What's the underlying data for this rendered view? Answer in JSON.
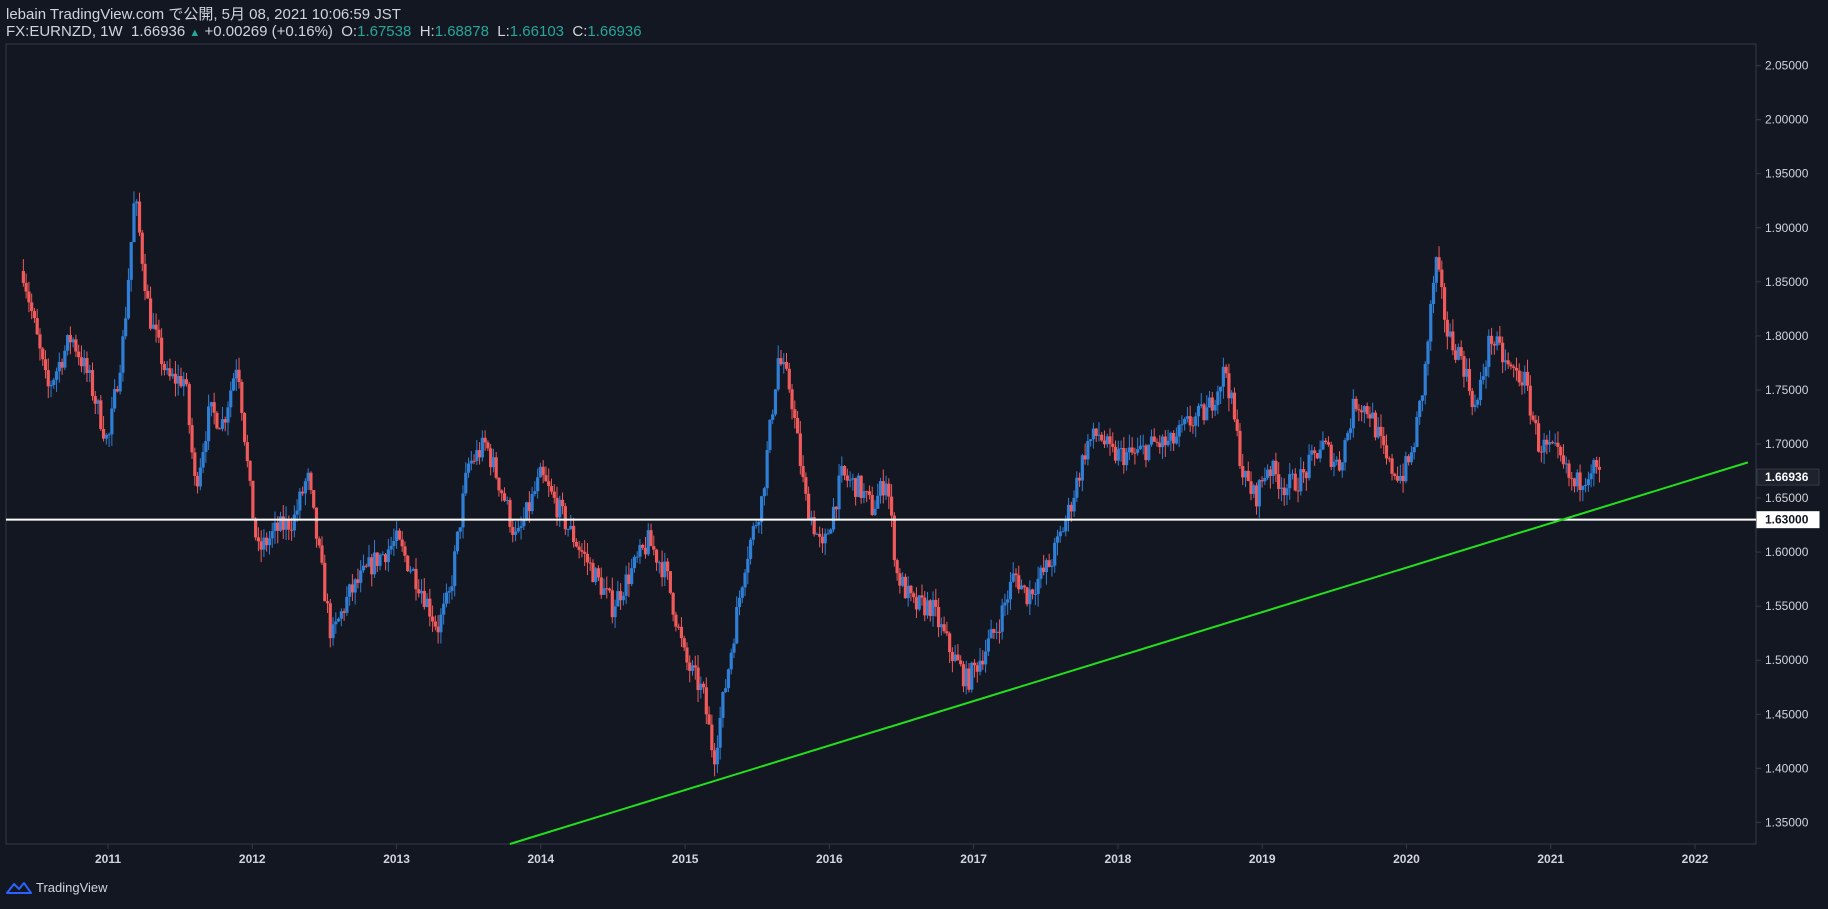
{
  "header": {
    "line1": "lebain TradingView.com で公開, 5月 08, 2021 10:06:59 JST",
    "symbol": "FX:EURNZD, 1W",
    "last": "1.66936",
    "change": "+0.00269 (+0.16%)",
    "o_label": "O:",
    "o": "1.67538",
    "h_label": "H:",
    "h": "1.68878",
    "l_label": "L:",
    "l": "1.66103",
    "c_label": "C:",
    "c": "1.66936"
  },
  "footer": {
    "brand": "TradingView",
    "icon": "tradingview-logo-icon"
  },
  "colors": {
    "background": "#131722",
    "up": "#2f7fd6",
    "down": "#f05a5a",
    "trendline": "#22e01d",
    "hline": "#ffffff",
    "axis_text": "#d1d4dc"
  },
  "chart_data": {
    "type": "candlestick",
    "symbol": "FX:EURNZD",
    "interval": "1W",
    "y_ticks": [
      "2.05000",
      "2.00000",
      "1.95000",
      "1.90000",
      "1.85000",
      "1.80000",
      "1.75000",
      "1.70000",
      "1.65000",
      "1.60000",
      "1.55000",
      "1.50000",
      "1.45000",
      "1.40000",
      "1.35000"
    ],
    "x_ticks": [
      "2011",
      "2012",
      "2013",
      "2014",
      "2015",
      "2016",
      "2017",
      "2018",
      "2019",
      "2020",
      "2021",
      "2022"
    ],
    "ylim": [
      1.33,
      2.07
    ],
    "last_price_label": "1.66936",
    "horizontal_line": {
      "price": 1.63,
      "label": "1.63000"
    },
    "trendline": {
      "from": {
        "date": "2013-10-15",
        "price": 1.33
      },
      "to": {
        "date": "2022-05-15",
        "price": 1.683
      }
    },
    "close_path": [
      [
        "2010-06-01",
        1.86
      ],
      [
        "2010-08-01",
        1.75
      ],
      [
        "2010-10-01",
        1.8
      ],
      [
        "2010-11-15",
        1.76
      ],
      [
        "2011-01-01",
        1.7
      ],
      [
        "2011-02-10",
        1.8
      ],
      [
        "2011-03-10",
        1.93
      ],
      [
        "2011-04-15",
        1.82
      ],
      [
        "2011-06-01",
        1.76
      ],
      [
        "2011-07-15",
        1.76
      ],
      [
        "2011-08-10",
        1.66
      ],
      [
        "2011-09-15",
        1.73
      ],
      [
        "2011-10-20",
        1.72
      ],
      [
        "2011-11-25",
        1.78
      ],
      [
        "2011-12-25",
        1.66
      ],
      [
        "2012-01-15",
        1.6
      ],
      [
        "2012-03-01",
        1.62
      ],
      [
        "2012-04-15",
        1.63
      ],
      [
        "2012-05-20",
        1.67
      ],
      [
        "2012-07-20",
        1.52
      ],
      [
        "2012-09-01",
        1.56
      ],
      [
        "2012-11-01",
        1.59
      ],
      [
        "2013-01-01",
        1.61
      ],
      [
        "2013-03-01",
        1.57
      ],
      [
        "2013-04-15",
        1.53
      ],
      [
        "2013-05-15",
        1.56
      ],
      [
        "2013-07-01",
        1.68
      ],
      [
        "2013-08-15",
        1.7
      ],
      [
        "2013-10-01",
        1.65
      ],
      [
        "2013-11-01",
        1.61
      ],
      [
        "2013-12-01",
        1.64
      ],
      [
        "2014-01-01",
        1.67
      ],
      [
        "2014-02-15",
        1.64
      ],
      [
        "2014-03-15",
        1.62
      ],
      [
        "2014-05-01",
        1.59
      ],
      [
        "2014-07-01",
        1.55
      ],
      [
        "2014-08-15",
        1.58
      ],
      [
        "2014-10-01",
        1.61
      ],
      [
        "2014-11-15",
        1.58
      ],
      [
        "2015-01-01",
        1.5
      ],
      [
        "2015-02-15",
        1.47
      ],
      [
        "2015-03-15",
        1.41
      ],
      [
        "2015-04-15",
        1.48
      ],
      [
        "2015-06-01",
        1.59
      ],
      [
        "2015-07-15",
        1.65
      ],
      [
        "2015-08-25",
        1.78
      ],
      [
        "2015-09-25",
        1.75
      ],
      [
        "2015-11-01",
        1.65
      ],
      [
        "2015-12-15",
        1.6
      ],
      [
        "2016-02-01",
        1.67
      ],
      [
        "2016-03-15",
        1.66
      ],
      [
        "2016-04-20",
        1.64
      ],
      [
        "2016-05-25",
        1.67
      ],
      [
        "2016-06-20",
        1.58
      ],
      [
        "2016-08-01",
        1.55
      ],
      [
        "2016-09-15",
        1.55
      ],
      [
        "2016-11-01",
        1.51
      ],
      [
        "2016-12-15",
        1.48
      ],
      [
        "2017-01-15",
        1.5
      ],
      [
        "2017-03-01",
        1.53
      ],
      [
        "2017-04-15",
        1.58
      ],
      [
        "2017-05-15",
        1.56
      ],
      [
        "2017-07-15",
        1.59
      ],
      [
        "2017-09-01",
        1.64
      ],
      [
        "2017-10-15",
        1.7
      ],
      [
        "2017-11-15",
        1.71
      ],
      [
        "2017-12-15",
        1.69
      ],
      [
        "2018-02-15",
        1.69
      ],
      [
        "2018-04-01",
        1.7
      ],
      [
        "2018-05-15",
        1.7
      ],
      [
        "2018-07-01",
        1.72
      ],
      [
        "2018-08-15",
        1.73
      ],
      [
        "2018-10-01",
        1.77
      ],
      [
        "2018-11-15",
        1.67
      ],
      [
        "2018-12-15",
        1.65
      ],
      [
        "2019-01-15",
        1.68
      ],
      [
        "2019-03-01",
        1.66
      ],
      [
        "2019-04-15",
        1.67
      ],
      [
        "2019-06-01",
        1.7
      ],
      [
        "2019-07-15",
        1.68
      ],
      [
        "2019-08-25",
        1.74
      ],
      [
        "2019-10-01",
        1.73
      ],
      [
        "2019-11-15",
        1.68
      ],
      [
        "2019-12-20",
        1.67
      ],
      [
        "2020-01-15",
        1.69
      ],
      [
        "2020-02-15",
        1.76
      ],
      [
        "2020-03-15",
        1.87
      ],
      [
        "2020-04-15",
        1.8
      ],
      [
        "2020-05-20",
        1.78
      ],
      [
        "2020-06-25",
        1.73
      ],
      [
        "2020-08-01",
        1.8
      ],
      [
        "2020-09-15",
        1.77
      ],
      [
        "2020-10-25",
        1.76
      ],
      [
        "2020-12-01",
        1.7
      ],
      [
        "2021-01-15",
        1.69
      ],
      [
        "2021-03-01",
        1.66
      ],
      [
        "2021-04-15",
        1.68
      ],
      [
        "2021-05-07",
        1.66936
      ]
    ]
  }
}
